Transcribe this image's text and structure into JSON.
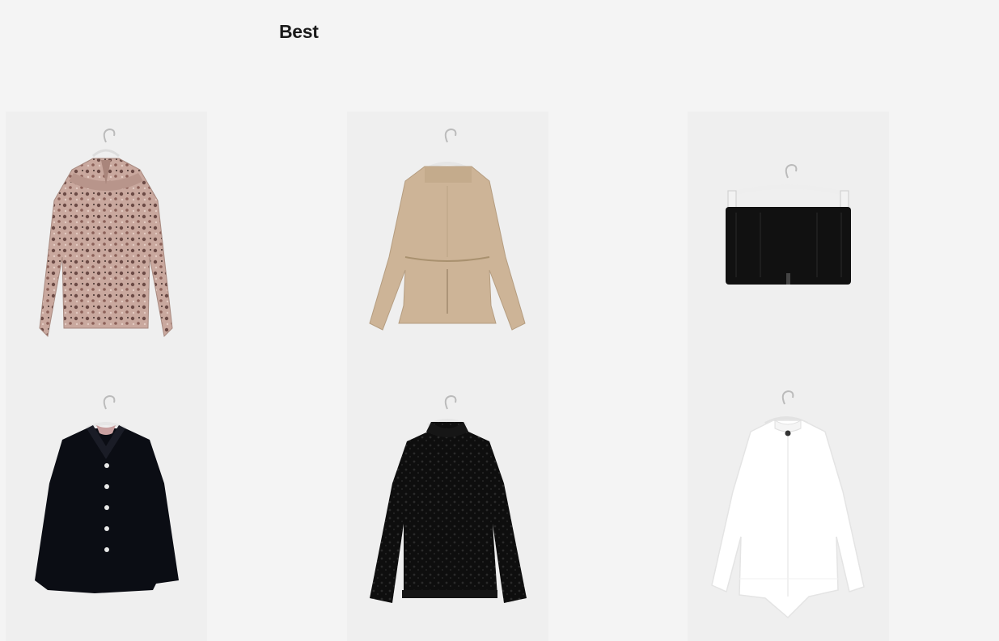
{
  "section": {
    "title": "Best"
  },
  "products": [
    {
      "icon": "floral-ruffle-blouse-image",
      "color": "#c5a59b"
    },
    {
      "icon": "beige-peplum-blouse-image",
      "color": "#cdb497"
    },
    {
      "icon": "black-tube-top-image",
      "color": "#111111"
    },
    {
      "icon": "black-button-blouse-image",
      "color": "#0b0d14"
    },
    {
      "icon": "black-velvet-lace-blouse-image",
      "color": "#101010"
    },
    {
      "icon": "white-band-collar-shirt-image",
      "color": "#ffffff"
    }
  ]
}
